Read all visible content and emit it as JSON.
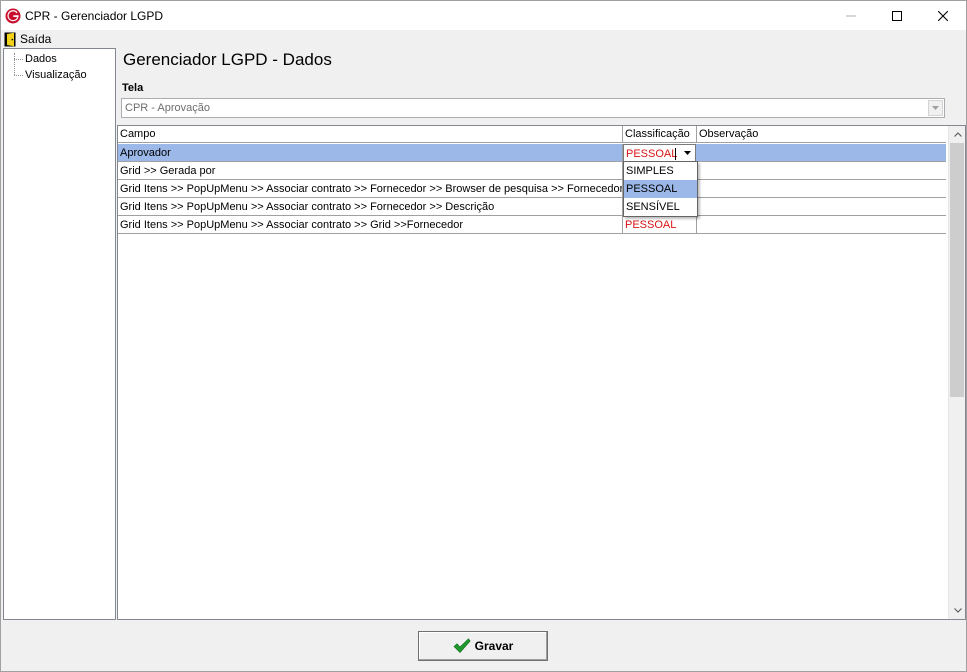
{
  "window": {
    "title": "CPR - Gerenciador LGPD"
  },
  "menu": {
    "exit_label": "Saída"
  },
  "tree": {
    "items": [
      "Dados",
      "Visualização"
    ]
  },
  "page": {
    "title": "Gerenciador LGPD - Dados"
  },
  "tela": {
    "label": "Tela",
    "value": "CPR - Aprovação"
  },
  "grid": {
    "columns": [
      "Campo",
      "Classificação",
      "Observação"
    ],
    "rows": [
      {
        "campo": "Aprovador",
        "classificacao": "PESSOAL",
        "observacao": ""
      },
      {
        "campo": "Grid >> Gerada por",
        "classificacao": "",
        "observacao": ""
      },
      {
        "campo": "Grid Itens >> PopUpMenu >> Associar contrato >> Fornecedor >> Browser de pesquisa >> Fornecedor",
        "classificacao": "",
        "observacao": ""
      },
      {
        "campo": "Grid Itens >> PopUpMenu >> Associar contrato >> Fornecedor >> Descrição",
        "classificacao": "",
        "observacao": ""
      },
      {
        "campo": "Grid Itens >> PopUpMenu >> Associar contrato >> Grid >>Fornecedor",
        "classificacao": "PESSOAL",
        "observacao": ""
      }
    ],
    "dropdown_options": [
      "SIMPLES",
      "PESSOAL",
      "SENSÍVEL"
    ],
    "dropdown_highlighted": "PESSOAL"
  },
  "footer": {
    "save_label": "Gravar"
  },
  "colors": {
    "selection": "#9cb8e8",
    "classification_text": "#d81414",
    "logo": "#c8102e"
  }
}
